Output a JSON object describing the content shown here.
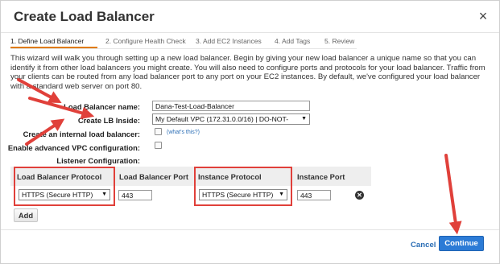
{
  "dialog": {
    "title": "Create Load Balancer",
    "close_glyph": "×"
  },
  "tabs": [
    {
      "label": "1. Define Load Balancer",
      "active": true
    },
    {
      "label": "2. Configure Health Check",
      "active": false
    },
    {
      "label": "3. Add EC2 Instances",
      "active": false
    },
    {
      "label": "4. Add Tags",
      "active": false
    },
    {
      "label": "5. Review",
      "active": false
    }
  ],
  "intro": "This wizard will walk you through setting up a new load balancer. Begin by giving your new load balancer a unique name so that you can identify it from other load balancers you might create. You will also need to configure ports and protocols for your load balancer. Traffic from your clients can be routed from any load balancer port to any port on your EC2 instances. By default, we've configured your load balancer with a standard web server on port 80.",
  "form": {
    "lb_name_label": "Load Balancer name:",
    "lb_name_value": "Dana-Test-Load-Balancer",
    "lb_inside_label": "Create LB Inside:",
    "lb_inside_value": "My Default VPC (172.31.0.0/16) | DO-NOT-",
    "internal_label": "Create an internal load balancer:",
    "whats_this": "(what's this?)",
    "advanced_vpc_label": "Enable advanced VPC configuration:",
    "listener_label": "Listener Configuration:"
  },
  "listener_table": {
    "headers": [
      "Load Balancer Protocol",
      "Load Balancer Port",
      "Instance Protocol",
      "Instance Port"
    ],
    "row": {
      "lb_protocol": "HTTPS (Secure HTTP)",
      "lb_port": "443",
      "instance_protocol": "HTTPS (Secure HTTP)",
      "instance_port": "443"
    },
    "add_label": "Add"
  },
  "footer": {
    "cancel_label": "Cancel",
    "continue_label": "Continue"
  },
  "colors": {
    "accent_tab": "#e07b00",
    "annotation_red": "#e0403a",
    "primary_button": "#2c7bd6",
    "link": "#2a6db5"
  },
  "icons": {
    "close": "close-icon",
    "remove": "remove-circle-icon",
    "dropdown": "chevron-down-icon"
  }
}
